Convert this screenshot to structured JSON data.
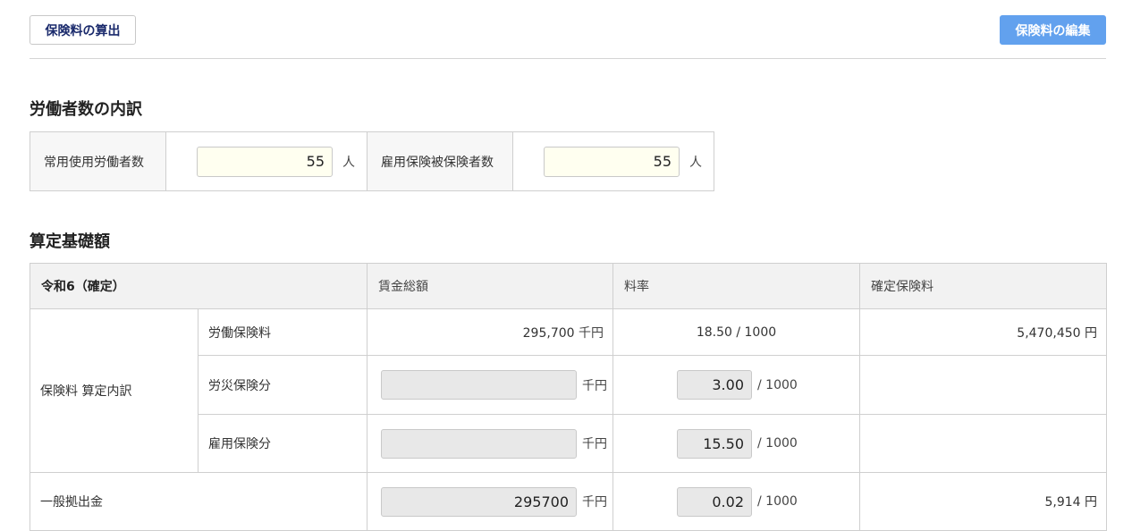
{
  "toolbar": {
    "calc_label": "保険料の算出",
    "edit_label": "保険料の編集"
  },
  "workers": {
    "title": "労働者数の内訳",
    "regular_label": "常用使用労働者数",
    "regular_value": "55",
    "insured_label": "雇用保険被保険者数",
    "insured_value": "55",
    "unit": "人"
  },
  "basis": {
    "title": "算定基礎額",
    "headers": {
      "period": "令和6（確定）",
      "wages": "賃金総額",
      "rate": "料率",
      "premium": "確定保険料"
    },
    "breakdown_label": "保険料 算定内訳",
    "labor": {
      "label": "労働保険料",
      "wages": "295,700",
      "wages_unit": "千円",
      "rate": "18.50 / 1000",
      "premium": "5,470,450 円"
    },
    "accident": {
      "label": "労災保険分",
      "wages": "",
      "wages_unit": "千円",
      "rate": "3.00",
      "rate_suffix": "/ 1000"
    },
    "employment": {
      "label": "雇用保険分",
      "wages": "",
      "wages_unit": "千円",
      "rate": "15.50",
      "rate_suffix": "/ 1000"
    },
    "general": {
      "label": "一般拠出金",
      "wages": "295700",
      "wages_unit": "千円",
      "rate": "0.02",
      "rate_suffix": "/ 1000",
      "premium": "5,914 円"
    }
  }
}
